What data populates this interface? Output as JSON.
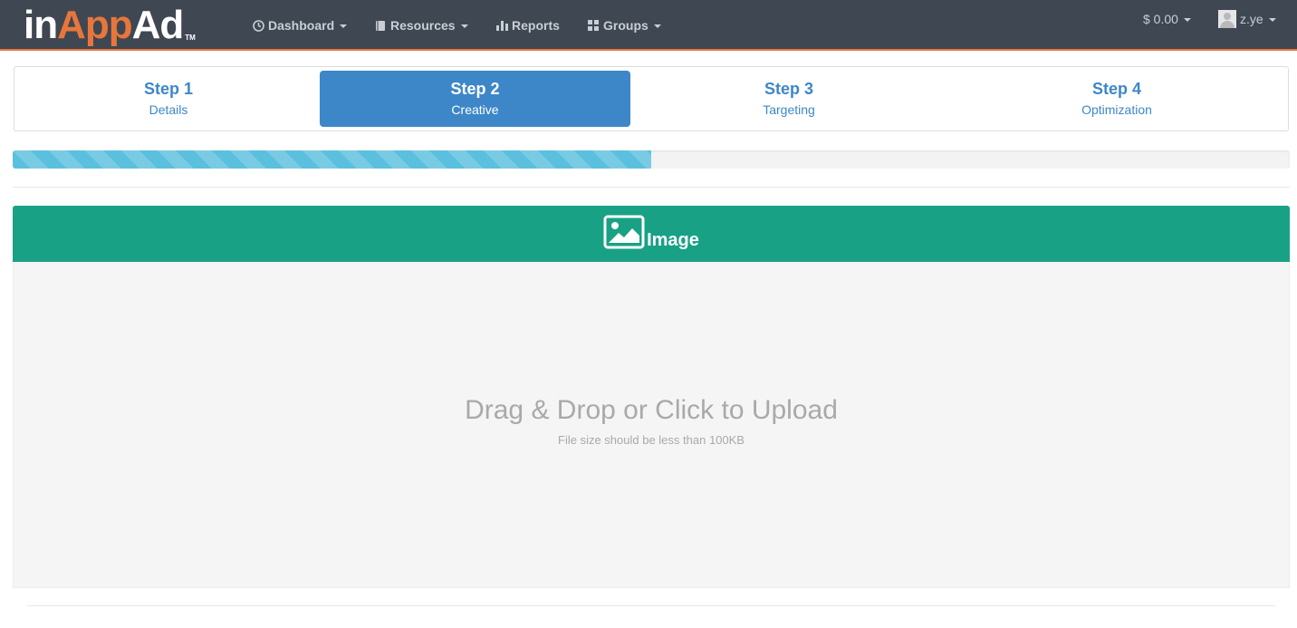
{
  "brand": {
    "logo_part1": "in",
    "logo_part2": "App",
    "logo_part3": "Ad",
    "logo_tm": "TM",
    "accent_color": "#e8763a"
  },
  "nav": {
    "dashboard": "Dashboard",
    "resources": "Resources",
    "reports": "Reports",
    "groups": "Groups",
    "balance": "$ 0.00",
    "user": "z.ye"
  },
  "steps": [
    {
      "title": "Step 1",
      "subtitle": "Details"
    },
    {
      "title": "Step 2",
      "subtitle": "Creative"
    },
    {
      "title": "Step 3",
      "subtitle": "Targeting"
    },
    {
      "title": "Step 4",
      "subtitle": "Optimization"
    }
  ],
  "active_step": 2,
  "progress": {
    "percent": 50,
    "color": "#5bc0de"
  },
  "panel": {
    "title": "Image",
    "color": "#18a185"
  },
  "dropzone": {
    "main_text": "Drag & Drop or Click to Upload",
    "sub_text": "File size should be less than 100KB"
  }
}
